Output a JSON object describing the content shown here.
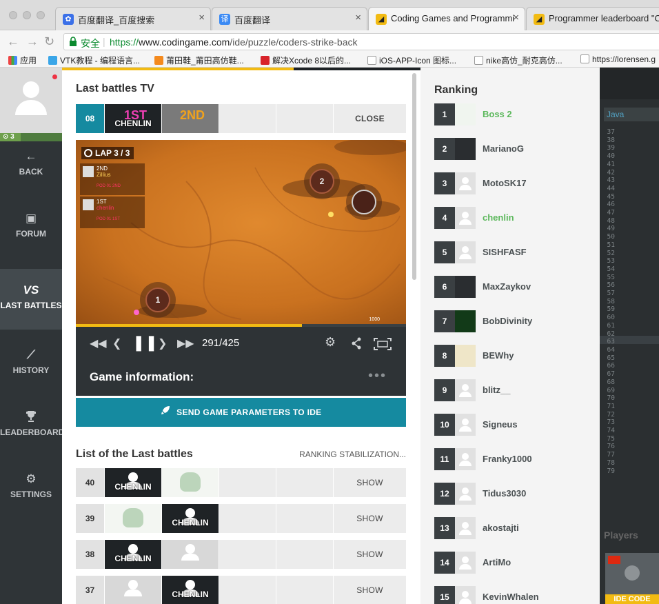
{
  "browser": {
    "tabs": [
      {
        "title": "百度翻译_百度搜索",
        "icon": "baidu-paw-icon",
        "color": "#3b70e8"
      },
      {
        "title": "百度翻译",
        "icon": "baidu-translate-icon",
        "color": "#3b8af4"
      },
      {
        "title": "Coding Games and Programmi",
        "icon": "codingame-icon",
        "color": "#f2bb13"
      },
      {
        "title": "Programmer leaderboard \"Co",
        "icon": "codingame-icon",
        "color": "#f2bb13"
      }
    ],
    "tab_close": "×",
    "secure_label": "安全",
    "url_scheme": "https://",
    "url_host": "www.codingame.com",
    "url_path": "/ide/puzzle/coders-strike-back",
    "bookmarks": [
      {
        "label": "应用",
        "icon": "apps-grid-icon"
      },
      {
        "label": "VTK教程 - 编程语言...",
        "icon": "vtk-icon"
      },
      {
        "label": "莆田鞋_莆田高仿鞋...",
        "icon": "shoe-icon"
      },
      {
        "label": "解决Xcode 8以后的...",
        "icon": "csdn-icon"
      },
      {
        "label": "iOS-APP-Icon 图标...",
        "icon": "bookmark-page-icon"
      },
      {
        "label": "nike高仿_耐克高仿...",
        "icon": "bookmark-page-icon"
      },
      {
        "label": "https://lorensen.g",
        "icon": "bookmark-page-icon"
      }
    ]
  },
  "sidebar": {
    "level": "3",
    "items": [
      {
        "label": "BACK",
        "icon": "arrow-left-icon",
        "glyph": "←"
      },
      {
        "label": "FORUM",
        "icon": "forum-icon",
        "glyph": "▣"
      },
      {
        "label": "LAST BATTLES",
        "icon": "versus-icon",
        "glyph": "VS",
        "active": true
      },
      {
        "label": "HISTORY",
        "icon": "history-chart-icon",
        "glyph": "⟋"
      },
      {
        "label": "LEADERBOARD",
        "icon": "trophy-icon",
        "glyph": "🏆"
      },
      {
        "label": "SETTINGS",
        "icon": "gear-icon",
        "glyph": "⚙"
      }
    ]
  },
  "tv": {
    "title": "Last battles TV",
    "battle_number": "08",
    "first_place": "1ST",
    "second_place": "2ND",
    "player1": "CHENLIN",
    "close_label": "CLOSE",
    "lap": "LAP 3 / 3",
    "panel1_place": "2ND",
    "panel1_name": "Zillius",
    "panel1_pod": "POD 01 2ND",
    "panel2_place": "1ST",
    "panel2_name": "chenlin",
    "panel2_pod": "POD 01 1ST",
    "checkpoint_1": "1",
    "checkpoint_2": "2",
    "scale": "1000",
    "frame": "291/425",
    "progress": 0.685,
    "game_info_label": "Game information:",
    "more": "•••",
    "send_label": "SEND GAME PARAMETERS TO IDE"
  },
  "battles": {
    "title": "List of the Last battles",
    "status": "RANKING STABILIZATION...",
    "show_label": "SHOW",
    "rows": [
      {
        "num": "40",
        "p1": "CHENLIN",
        "p2": "boss"
      },
      {
        "num": "39",
        "p1": "boss",
        "p2": "CHENLIN"
      },
      {
        "num": "38",
        "p1": "CHENLIN",
        "p2": "anon"
      },
      {
        "num": "37",
        "p1": "anon",
        "p2": "CHENLIN"
      }
    ]
  },
  "ranking": {
    "title": "Ranking",
    "rows": [
      {
        "rank": "1",
        "name": "Boss 2",
        "highlight": true,
        "avatar": "skull"
      },
      {
        "rank": "2",
        "name": "MarianoG",
        "highlight": false,
        "avatar": "dark"
      },
      {
        "rank": "3",
        "name": "MotoSK17",
        "highlight": false,
        "avatar": "anon"
      },
      {
        "rank": "4",
        "name": "chenlin",
        "highlight": true,
        "avatar": "anon"
      },
      {
        "rank": "5",
        "name": "SISHFASF",
        "highlight": false,
        "avatar": "anon"
      },
      {
        "rank": "6",
        "name": "MaxZaykov",
        "highlight": false,
        "avatar": "dark"
      },
      {
        "rank": "7",
        "name": "BobDivinity",
        "highlight": false,
        "avatar": "green"
      },
      {
        "rank": "8",
        "name": "BEWhy",
        "highlight": false,
        "avatar": "beige"
      },
      {
        "rank": "9",
        "name": "blitz__",
        "highlight": false,
        "avatar": "anon"
      },
      {
        "rank": "10",
        "name": "Signeus",
        "highlight": false,
        "avatar": "anon"
      },
      {
        "rank": "11",
        "name": "Franky1000",
        "highlight": false,
        "avatar": "anon"
      },
      {
        "rank": "12",
        "name": "Tidus3030",
        "highlight": false,
        "avatar": "anon"
      },
      {
        "rank": "13",
        "name": "akostajti",
        "highlight": false,
        "avatar": "anon"
      },
      {
        "rank": "14",
        "name": "ArtiMo",
        "highlight": false,
        "avatar": "anon"
      },
      {
        "rank": "15",
        "name": "KevinWhalen",
        "highlight": false,
        "avatar": "anon"
      }
    ]
  },
  "ide": {
    "language": "Java",
    "line_numbers": [
      "37",
      "38",
      "39",
      "40",
      "41",
      "42",
      "43",
      "44",
      "45",
      "46",
      "47",
      "48",
      "49",
      "50",
      "51",
      "52",
      "53",
      "54",
      "55",
      "56",
      "57",
      "58",
      "59",
      "60",
      "61",
      "62",
      "63",
      "64",
      "65",
      "66",
      "67",
      "68",
      "69",
      "70",
      "71",
      "72",
      "73",
      "74",
      "75",
      "76",
      "77",
      "78",
      "79"
    ],
    "players_label": "Players",
    "ide_code_label": "IDE CODE"
  }
}
